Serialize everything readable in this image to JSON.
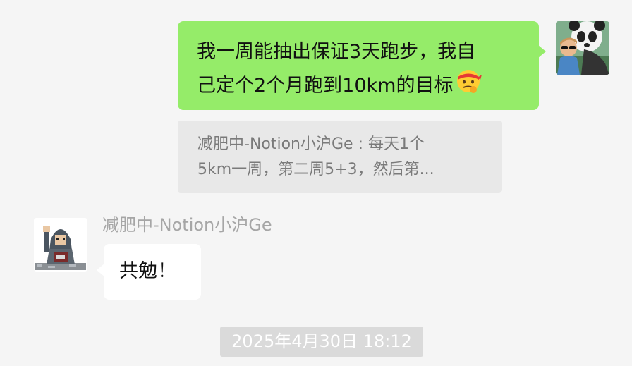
{
  "outgoing_message": {
    "line1": "我一周能抽出保证3天跑步，我自",
    "line2": "己定个2个月跑到10km的目标",
    "emoji": "headband-thinking-face-emoji"
  },
  "quote": {
    "line1": "减肥中-Notion小沪Ge : 每天1个",
    "line2": "5km一周，第二周5+3，然后第..."
  },
  "incoming": {
    "sender_name": "减肥中-Notion小沪Ge",
    "message": "共勉！"
  },
  "timestamp": "2025年4月30日 18:12",
  "colors": {
    "background": "#f5f5f5",
    "outgoing_bubble": "#95ec69",
    "incoming_bubble": "#ffffff",
    "quote_bg": "#e8e8e8",
    "timestamp_bg": "#dadada"
  }
}
